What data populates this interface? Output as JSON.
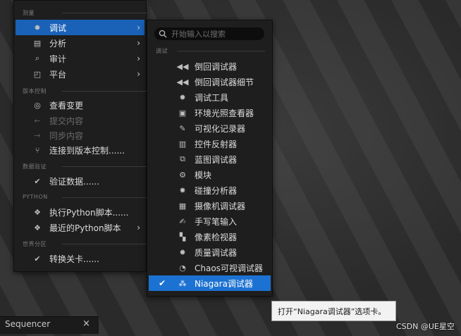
{
  "left_menu": {
    "sections": {
      "measure": "测量",
      "source_control": "版本控制",
      "data_validation": "数据验证",
      "python": "PYTHON",
      "world_partition": "世界分区"
    },
    "items": [
      {
        "label": "调试",
        "icon": "debug-bug-icon",
        "submenu": true,
        "active": true
      },
      {
        "label": "分析",
        "icon": "analyze-icon",
        "submenu": true
      },
      {
        "label": "审计",
        "icon": "audit-icon",
        "submenu": true
      },
      {
        "label": "平台",
        "icon": "platform-icon",
        "submenu": true
      },
      {
        "label": "查看变更",
        "icon": "view-changes-icon"
      },
      {
        "label": "提交内容",
        "icon": "submit-arrow-icon",
        "disabled": true
      },
      {
        "label": "同步内容",
        "icon": "sync-arrow-icon",
        "disabled": true
      },
      {
        "label": "连接到版本控制......",
        "icon": "connect-vcs-icon"
      },
      {
        "label": "验证数据......",
        "icon": "validate-data-icon"
      },
      {
        "label": "执行Python脚本......",
        "icon": "python-icon"
      },
      {
        "label": "最近的Python脚本",
        "icon": "recent-python-icon",
        "submenu": true
      },
      {
        "label": "转换关卡......",
        "icon": "convert-level-icon"
      }
    ]
  },
  "right_menu": {
    "search_placeholder": "开始输入以搜索",
    "section": "调试",
    "items": [
      {
        "label": "倒回调试器",
        "icon": "rewind-icon"
      },
      {
        "label": "倒回调试器细节",
        "icon": "rewind-details-icon"
      },
      {
        "label": "调试工具",
        "icon": "debug-tools-icon"
      },
      {
        "label": "环境光照查看器",
        "icon": "env-light-icon"
      },
      {
        "label": "可视化记录器",
        "icon": "visual-logger-icon"
      },
      {
        "label": "控件反射器",
        "icon": "widget-reflector-icon"
      },
      {
        "label": "蓝图调试器",
        "icon": "blueprint-debugger-icon"
      },
      {
        "label": "模块",
        "icon": "modules-icon"
      },
      {
        "label": "碰撞分析器",
        "icon": "collision-analyzer-icon"
      },
      {
        "label": "摄像机调试器",
        "icon": "camera-debugger-icon"
      },
      {
        "label": "手写笔输入",
        "icon": "stylus-input-icon"
      },
      {
        "label": "像素检视器",
        "icon": "pixel-inspector-icon"
      },
      {
        "label": "质量调试器",
        "icon": "mass-debugger-icon"
      },
      {
        "label": "Chaos可视调试器",
        "icon": "chaos-debugger-icon"
      },
      {
        "label": "Niagara调试器",
        "icon": "niagara-icon",
        "checked": true,
        "selected": true
      }
    ]
  },
  "tooltip": "打开“Niagara调试器”选项卡。",
  "tab": {
    "label": "Sequencer",
    "close": "×"
  },
  "watermark": "CSDN @UE星空",
  "colors": {
    "selected": "#1c72d2",
    "active": "#1a61b8",
    "menu_bg": "#1e1e1e"
  }
}
